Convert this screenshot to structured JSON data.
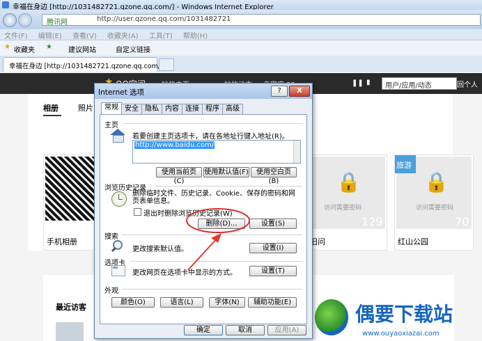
{
  "window": {
    "title": "幸福在身边 [http://1031482721.qzone.qq.com/] - Windows Internet Explorer"
  },
  "address": {
    "site_label": "腾讯网",
    "url": "http://user.qzone.qq.com/1031482721"
  },
  "menu": [
    "文件(F)",
    "编辑(E)",
    "查看(V)",
    "收藏夹(A)",
    "工具(T)",
    "帮助(H)"
  ],
  "favorites_bar": {
    "favorites": "收藏夹",
    "suggested": "建议网站",
    "custom": "自定义链接"
  },
  "tab": {
    "title": "幸福在身边 [http://1031482721.qzone.qq.com/]"
  },
  "qzone": {
    "logo": "QQ空间",
    "nav": [
      "她的主页",
      "她的动态",
      "亲密度 52"
    ],
    "search_placeholder": "用户/应用/动态",
    "back": "返回个人",
    "subnav": [
      "相册",
      "照片"
    ],
    "albums": [
      {
        "name": "手机相册"
      },
      {
        "name": "",
        "badge": "",
        "need": "访问需要密码",
        "count": "129",
        "place": "旧问"
      },
      {
        "name": "红山公园",
        "badge": "旅游",
        "need": "访问需要密码",
        "count": "70"
      }
    ],
    "recent_visitors": "最近访客"
  },
  "dialog": {
    "title": "Internet 选项",
    "help": "?",
    "close": "X",
    "tabs": [
      "常规",
      "安全",
      "隐私",
      "内容",
      "连接",
      "程序",
      "高级"
    ],
    "home": {
      "section": "主页",
      "desc": "若要创建主页选项卡，请在各地址行键入地址(R)。",
      "value": "http://www.baidu.com/",
      "use_current": "使用当前页(C)",
      "use_default": "使用默认值(F)",
      "use_blank": "使用空白页(B)"
    },
    "history": {
      "section": "浏览历史记录",
      "desc": "删除临时文件、历史记录、Cookie、保存的密码和网页表单信息。",
      "checkbox": "退出时删除浏览历史记录(W)",
      "delete": "删除(D)...",
      "settings": "设置(S)"
    },
    "search": {
      "section": "搜索",
      "desc": "更改搜索默认值。",
      "settings": "设置(I)"
    },
    "tabs_sec": {
      "section": "选项卡",
      "desc": "更改网页在选项卡中显示的方式。",
      "settings": "设置(T)"
    },
    "appearance": {
      "section": "外观",
      "colors": "颜色(O)",
      "languages": "语言(L)",
      "fonts": "字体(N)",
      "accessibility": "辅助功能(E)"
    },
    "ok": "确定",
    "cancel": "取消",
    "apply": "应用(A)"
  },
  "watermark": {
    "text": "偶要下载站",
    "url": "www.ouyaoxiazai.com"
  },
  "colors": {
    "highlight_circle": "#d9302c",
    "arrow": "#e23a2f",
    "watermark": "#1565c0"
  }
}
